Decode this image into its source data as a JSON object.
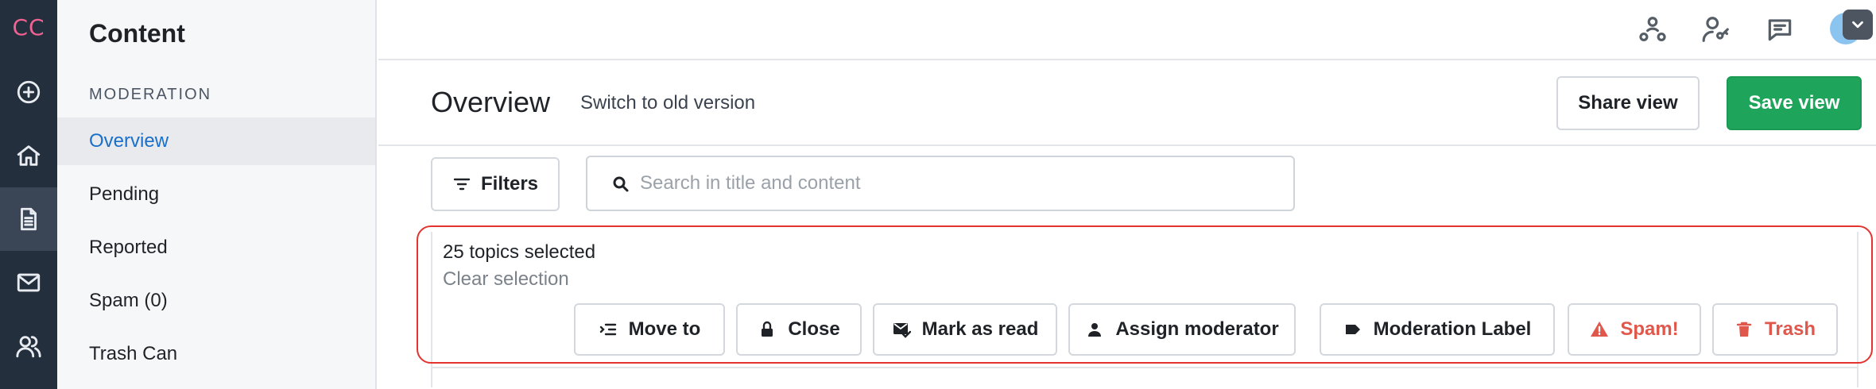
{
  "app": {
    "logo_text": "CC"
  },
  "rail": {
    "items": [
      {
        "icon": "plus-circle-icon"
      },
      {
        "icon": "home-icon"
      },
      {
        "icon": "document-icon",
        "active": true
      },
      {
        "icon": "mail-icon"
      },
      {
        "icon": "users-icon"
      }
    ]
  },
  "sidebar": {
    "title": "Content",
    "section_label": "MODERATION",
    "items": [
      {
        "label": "Overview",
        "active": true
      },
      {
        "label": "Pending"
      },
      {
        "label": "Reported"
      },
      {
        "label": "Spam (0)"
      },
      {
        "label": "Trash Can"
      }
    ]
  },
  "topbar": {
    "icons": [
      "community-icon",
      "user-key-icon",
      "chat-icon",
      "avatar"
    ]
  },
  "header": {
    "title": "Overview",
    "old_version_link": "Switch to old version",
    "share_label": "Share view",
    "save_label": "Save view"
  },
  "toolbar": {
    "filters_label": "Filters",
    "search_placeholder": "Search in title and content",
    "search_value": ""
  },
  "selection": {
    "count_text": "25 topics selected",
    "clear_label": "Clear selection",
    "actions": [
      {
        "label": "Move to",
        "icon": "move-list-icon"
      },
      {
        "label": "Close",
        "icon": "lock-icon"
      },
      {
        "label": "Mark as read",
        "icon": "mail-check-icon"
      },
      {
        "label": "Assign moderator",
        "icon": "person-icon"
      },
      {
        "label": "Moderation Label",
        "icon": "tag-icon"
      },
      {
        "label": "Spam!",
        "icon": "warning-icon",
        "danger": true
      },
      {
        "label": "Trash",
        "icon": "trash-icon",
        "danger": true
      }
    ]
  },
  "colors": {
    "rail_bg": "#242f3d",
    "accent_blue": "#1a6fc9",
    "save_green": "#1ea55b",
    "danger_red": "#e0574c",
    "selection_outline": "#e3342f",
    "logo_pink": "#f06292"
  }
}
